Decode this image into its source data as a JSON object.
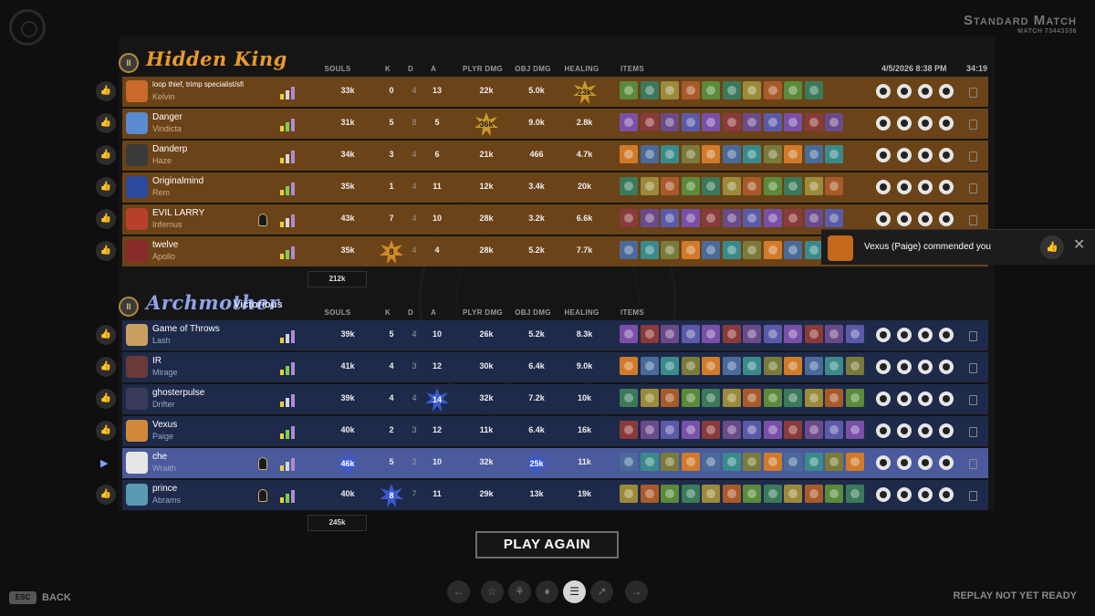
{
  "header": {
    "mode_title": "Standard Match",
    "match_id": "MATCH 73443336"
  },
  "columns": {
    "souls": "SOULS",
    "k": "K",
    "d": "D",
    "a": "A",
    "plyr_dmg": "PLYR DMG",
    "obj_dmg": "OBJ DMG",
    "healing": "HEALING",
    "items": "ITEMS"
  },
  "match_info": {
    "date": "4/5/2026 8:38 PM",
    "duration": "34:19"
  },
  "colors": {
    "hidden_king": "#e89a2a",
    "archmother": "#8ea3e8",
    "row_king": "#6b4318",
    "row_arch": "#1e2a4a",
    "row_selected": "#4a5a9c"
  },
  "teams": [
    {
      "badge": "II",
      "name": "Hidden King",
      "result": "",
      "total_souls": "212k",
      "players": [
        {
          "name": "loop thief, trimp specialist/sfi",
          "hero": "Kelvin",
          "souls": "33k",
          "k": "0",
          "d": "4",
          "a": "13",
          "plyr_dmg": "22k",
          "obj_dmg": "5.0k",
          "healing": "23k"
        },
        {
          "name": "Danger",
          "hero": "Vindicta",
          "souls": "31k",
          "k": "5",
          "d": "8",
          "a": "5",
          "plyr_dmg": "36k",
          "obj_dmg": "9.0k",
          "healing": "2.8k"
        },
        {
          "name": "Danderp",
          "hero": "Haze",
          "souls": "34k",
          "k": "3",
          "d": "4",
          "a": "6",
          "plyr_dmg": "21k",
          "obj_dmg": "466",
          "healing": "4.7k"
        },
        {
          "name": "Originalmind",
          "hero": "Rem",
          "souls": "35k",
          "k": "1",
          "d": "4",
          "a": "11",
          "plyr_dmg": "12k",
          "obj_dmg": "3.4k",
          "healing": "20k"
        },
        {
          "name": "EVIL LARRY",
          "hero": "Infernus",
          "souls": "43k",
          "k": "7",
          "d": "4",
          "a": "10",
          "plyr_dmg": "28k",
          "obj_dmg": "3.2k",
          "healing": "6.6k"
        },
        {
          "name": "twelve",
          "hero": "Apollo",
          "souls": "35k",
          "k": "8",
          "d": "4",
          "a": "4",
          "plyr_dmg": "28k",
          "obj_dmg": "5.2k",
          "healing": "7.7k"
        }
      ]
    },
    {
      "badge": "II",
      "name": "Archmother",
      "result": "Victorious",
      "total_souls": "245k",
      "players": [
        {
          "name": "Game of Throws",
          "hero": "Lash",
          "souls": "39k",
          "k": "5",
          "d": "4",
          "a": "10",
          "plyr_dmg": "26k",
          "obj_dmg": "5.2k",
          "healing": "8.3k"
        },
        {
          "name": "IR",
          "hero": "Mirage",
          "souls": "41k",
          "k": "4",
          "d": "3",
          "a": "12",
          "plyr_dmg": "30k",
          "obj_dmg": "6.4k",
          "healing": "9.0k"
        },
        {
          "name": "ghosterpulse",
          "hero": "Drifter",
          "souls": "39k",
          "k": "4",
          "d": "4",
          "a": "14",
          "plyr_dmg": "32k",
          "obj_dmg": "7.2k",
          "healing": "10k"
        },
        {
          "name": "Vexus",
          "hero": "Paige",
          "souls": "40k",
          "k": "2",
          "d": "3",
          "a": "12",
          "plyr_dmg": "11k",
          "obj_dmg": "6.4k",
          "healing": "16k"
        },
        {
          "name": "che",
          "hero": "Wraith",
          "souls": "46k",
          "k": "5",
          "d": "3",
          "a": "10",
          "plyr_dmg": "32k",
          "obj_dmg": "25k",
          "healing": "11k"
        },
        {
          "name": "prince",
          "hero": "Abrams",
          "souls": "40k",
          "k": "8",
          "d": "7",
          "a": "11",
          "plyr_dmg": "29k",
          "obj_dmg": "13k",
          "healing": "19k"
        }
      ]
    }
  ],
  "toast": {
    "text": "Vexus (Paige) commended you"
  },
  "buttons": {
    "play_again": "PLAY AGAIN",
    "esc": "ESC",
    "back": "BACK",
    "replay_status": "REPLAY NOT YET READY"
  },
  "nav_icons": [
    "arrow-left-icon",
    "trophy-icon",
    "damage-icon",
    "shield-icon",
    "scoreboard-icon",
    "graph-icon",
    "arrow-right-icon"
  ]
}
